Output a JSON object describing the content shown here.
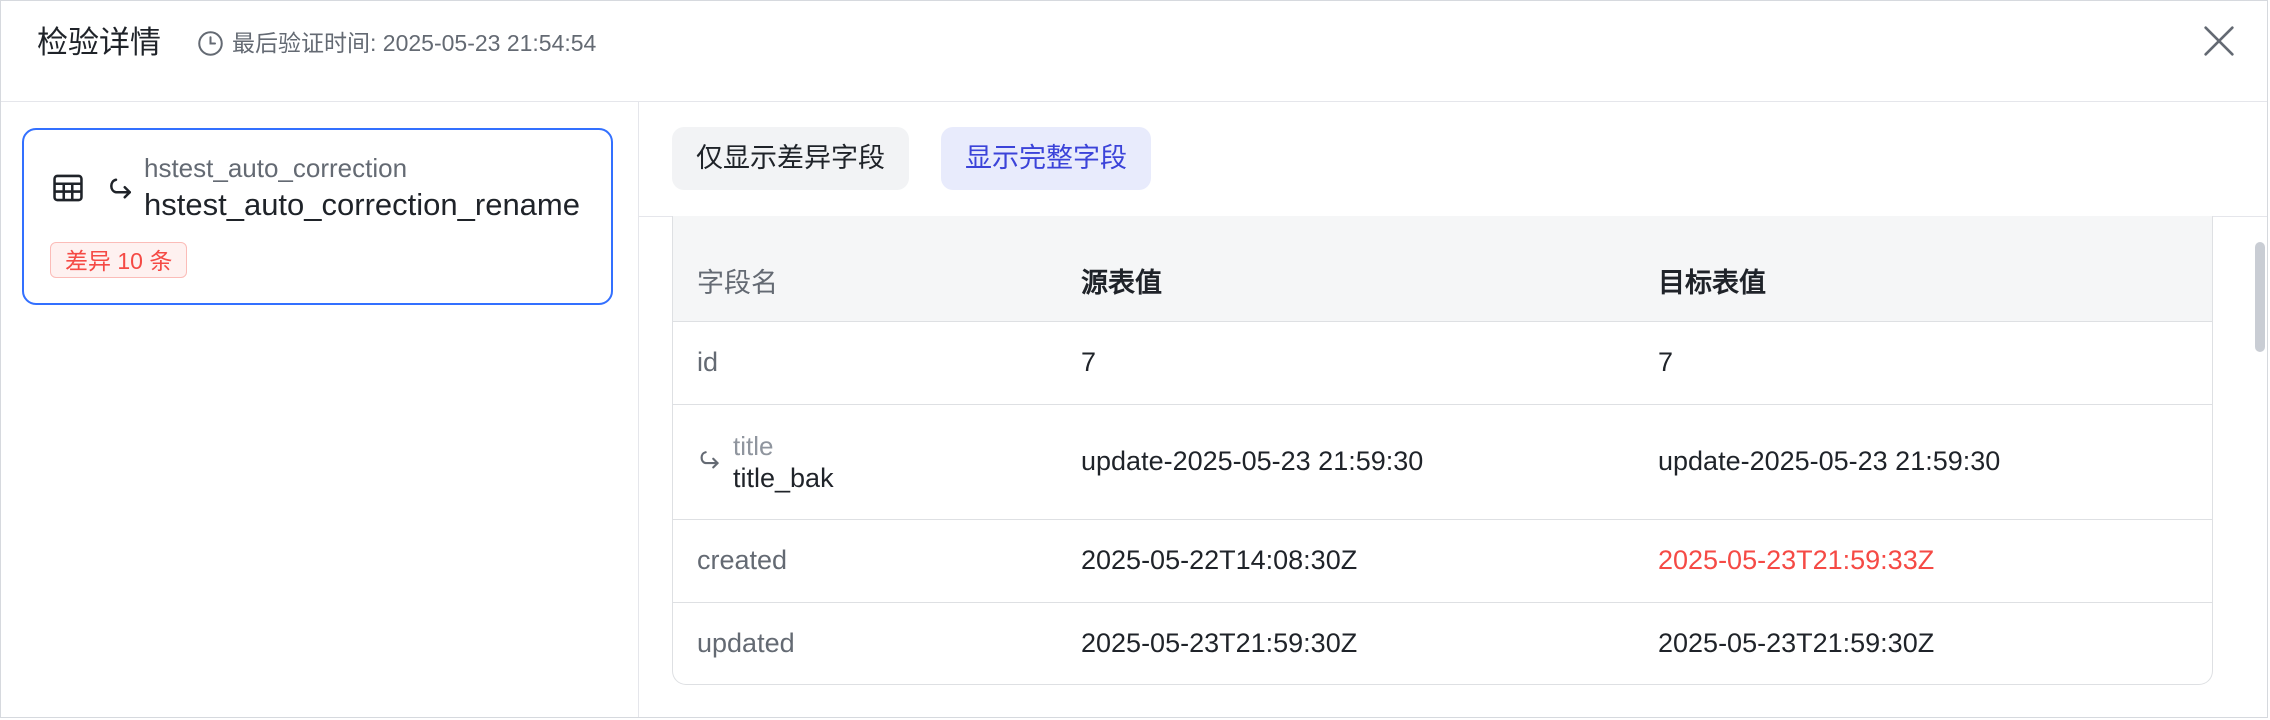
{
  "dialog": {
    "title": "检验详情",
    "last_verify": "最后验证时间: 2025-05-23 21:54:54"
  },
  "table_card": {
    "source_name": "hstest_auto_correction",
    "target_name": "hstest_auto_correction_rename",
    "diff_badge": "差异 10 条"
  },
  "toolbar": {
    "show_diff_label": "仅显示差异字段",
    "show_full_label": "显示完整字段",
    "active": "show_full"
  },
  "grid": {
    "headers": [
      "字段名",
      "源表值",
      "目标表值"
    ],
    "rows": [
      {
        "field": "id",
        "source": "7",
        "target": "7"
      },
      {
        "field_old": "title",
        "field_new": "title_bak",
        "source": "update-2025-05-23 21:59:30",
        "target": "update-2025-05-23 21:59:30"
      },
      {
        "field": "created",
        "source": "2025-05-22T14:08:30Z",
        "target": "2025-05-23T21:59:33Z",
        "target_differs": true
      },
      {
        "field": "updated",
        "source": "2025-05-23T21:59:30Z",
        "target": "2025-05-23T21:59:30Z"
      }
    ]
  },
  "colors": {
    "accent": "#3370ff",
    "diff": "#f54a45",
    "active_segment_bg": "#e8ebfc"
  },
  "icons": [
    "clock-icon",
    "close-icon",
    "table-icon",
    "rename-arrow-icon"
  ]
}
